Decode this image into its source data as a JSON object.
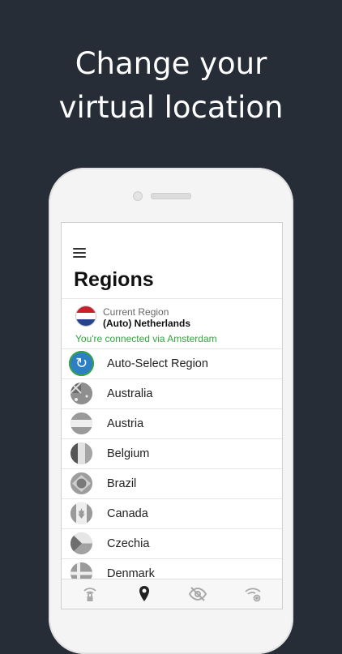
{
  "headline": {
    "line1": "Change your",
    "line2": "virtual location"
  },
  "screen": {
    "title": "Regions",
    "current": {
      "label": "Current Region",
      "name": "(Auto) Netherlands",
      "status": "You're connected via Amsterdam"
    },
    "regions": [
      {
        "label": "Auto-Select Region",
        "icon": "refresh-icon"
      },
      {
        "label": "Australia",
        "icon": "flag-australia-icon"
      },
      {
        "label": "Austria",
        "icon": "flag-austria-icon"
      },
      {
        "label": "Belgium",
        "icon": "flag-belgium-icon"
      },
      {
        "label": "Brazil",
        "icon": "flag-brazil-icon"
      },
      {
        "label": "Canada",
        "icon": "flag-canada-icon"
      },
      {
        "label": "Czechia",
        "icon": "flag-czechia-icon"
      },
      {
        "label": "Denmark",
        "icon": "flag-denmark-icon"
      }
    ],
    "tabs": [
      {
        "icon": "wifi-lock-icon",
        "active": false
      },
      {
        "icon": "location-pin-icon",
        "active": true
      },
      {
        "icon": "eye-off-icon",
        "active": false
      },
      {
        "icon": "wifi-settings-icon",
        "active": false
      }
    ]
  },
  "colors": {
    "background": "#262d36",
    "connected_green": "#35a33f",
    "auto_blue": "#2d7fc5",
    "tab_inactive": "#a9a9a9",
    "tab_active": "#222222"
  }
}
